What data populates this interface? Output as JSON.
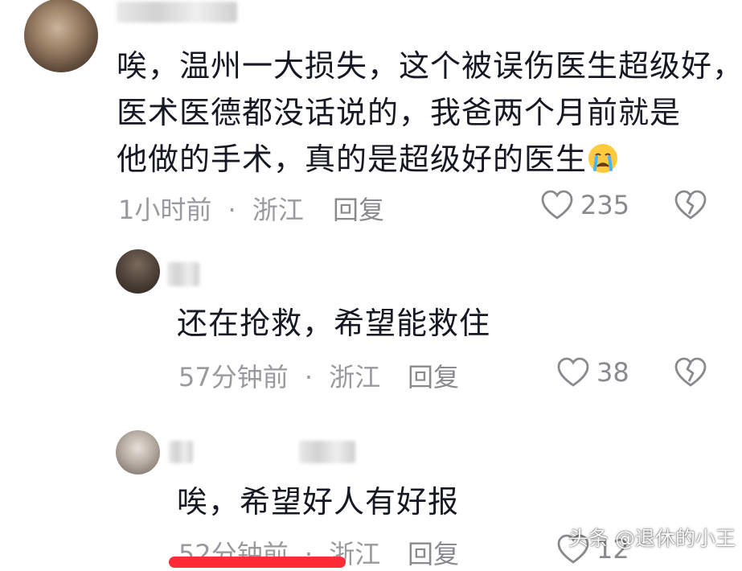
{
  "comments": [
    {
      "text_lines": [
        "唉，温州一大损失，这个被误伤医生超级好，",
        "医术医德都没话说的，我爸两个月前就是",
        "他做的手术，真的是超级好的医生"
      ],
      "emoji": "crying-face-emoji",
      "time": "1小时前",
      "location": "浙江",
      "reply_label": "回复",
      "likes": "235"
    },
    {
      "text_lines": [
        "还在抢救，希望能救住"
      ],
      "time": "57分钟前",
      "location": "浙江",
      "reply_label": "回复",
      "likes": "38"
    },
    {
      "text_lines": [
        "唉，希望好人有好报"
      ],
      "time": "52分钟前",
      "location": "浙江",
      "reply_label": "回复",
      "likes": "12"
    }
  ],
  "meta_separator": "·",
  "watermark": "头条 @退休的小王",
  "colors": {
    "text": "#161823",
    "meta": "#9a9a9e",
    "accent_bar": "#ff2b36"
  }
}
